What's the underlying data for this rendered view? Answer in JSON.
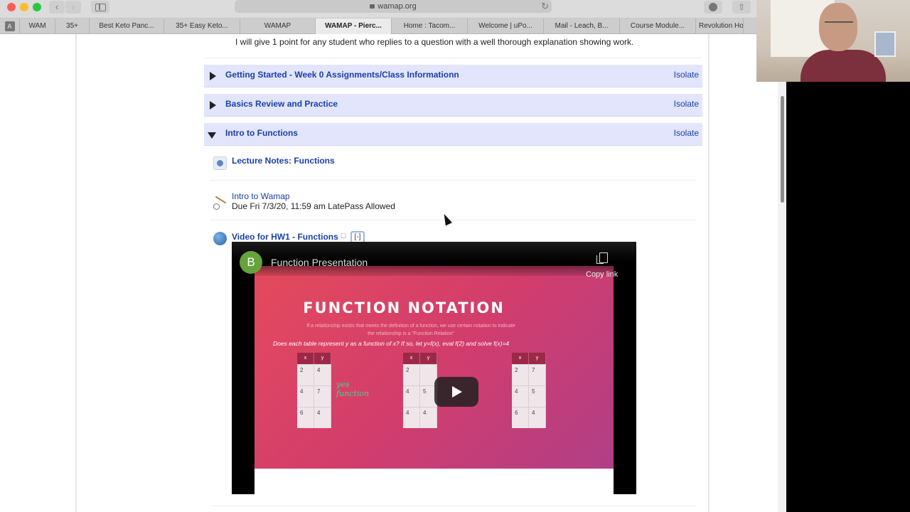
{
  "browser": {
    "address": "wamap.org",
    "tabs": [
      {
        "label": "WAM"
      },
      {
        "label": "35+"
      },
      {
        "label": "Best Keto Panc..."
      },
      {
        "label": "35+ Easy Keto..."
      },
      {
        "label": "WAMAP"
      },
      {
        "label": "WAMAP - Pierc..."
      },
      {
        "label": "Home : Tacom..."
      },
      {
        "label": "Welcome | uPo..."
      },
      {
        "label": "Mail - Leach, B..."
      },
      {
        "label": "Course Module..."
      },
      {
        "label": "Revolution Ho"
      }
    ],
    "tab_a_label": "A"
  },
  "page": {
    "intro_text": "I will give 1 point for any student who replies to a question with a well thorough explanation showing work.",
    "blocks": [
      {
        "title": "Getting Started - Week 0 Assignments/Class Informationn",
        "isolate": "Isolate"
      },
      {
        "title": "Basics Review and Practice",
        "isolate": "Isolate"
      },
      {
        "title": "Intro to Functions",
        "isolate": "Isolate"
      }
    ],
    "items": [
      {
        "title": "Lecture Notes: Functions"
      },
      {
        "title": "Intro to Wamap",
        "due": "Due Fri 7/3/20, 11:59 am LatePass Allowed"
      },
      {
        "title": "Video for HW1 - Functions",
        "collapse": "[-]"
      }
    ]
  },
  "video": {
    "channel_initial": "B",
    "title": "Function Presentation",
    "copy_link": "Copy link",
    "slide": {
      "heading": "FUNCTION NOTATION",
      "subtext": "If a relationship exists that meets the definition of a function, we use certain notation to indicate the relationship is a \"Function Relation\"",
      "question": "Does each table represent y as a function of x?  If so, let y=f(x), eval f(2) and solve f(x)=4",
      "tables": [
        {
          "head": [
            "x",
            "y"
          ],
          "rows": [
            [
              "2",
              "4"
            ],
            [
              "4",
              "7"
            ],
            [
              "6",
              "4"
            ]
          ]
        },
        {
          "head": [
            "x",
            "y"
          ],
          "rows": [
            [
              "2",
              ""
            ],
            [
              "4",
              "5"
            ],
            [
              "4",
              "4"
            ]
          ]
        },
        {
          "head": [
            "x",
            "y"
          ],
          "rows": [
            [
              "2",
              "7"
            ],
            [
              "4",
              "5"
            ],
            [
              "6",
              "4"
            ]
          ]
        }
      ],
      "scribble": "yes function"
    }
  }
}
